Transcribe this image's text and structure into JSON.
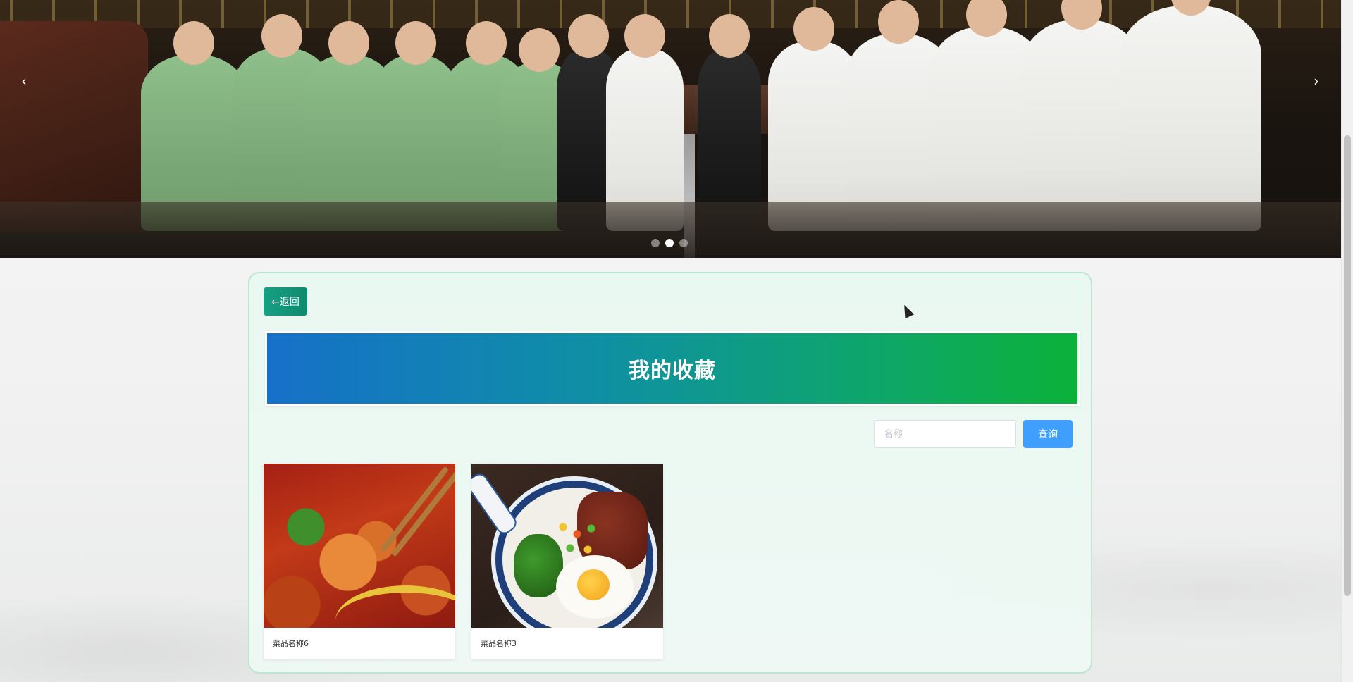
{
  "hero": {
    "prev_icon": "‹",
    "next_icon": "›",
    "slides_count": 3,
    "active_slide": 2
  },
  "actions": {
    "back_label": "←返回"
  },
  "page": {
    "title": "我的收藏"
  },
  "search": {
    "placeholder": "名称",
    "button_label": "查询"
  },
  "favorites": [
    {
      "name": "菜品名称6",
      "image": "shrimp-dish"
    },
    {
      "name": "菜品名称3",
      "image": "braised-pork-rice-bowl"
    }
  ],
  "colors": {
    "back_button": "#16a085",
    "search_button": "#409eff",
    "banner_start": "#1670c9",
    "banner_end": "#0cb13a",
    "panel_border": "#b9e7cf"
  }
}
